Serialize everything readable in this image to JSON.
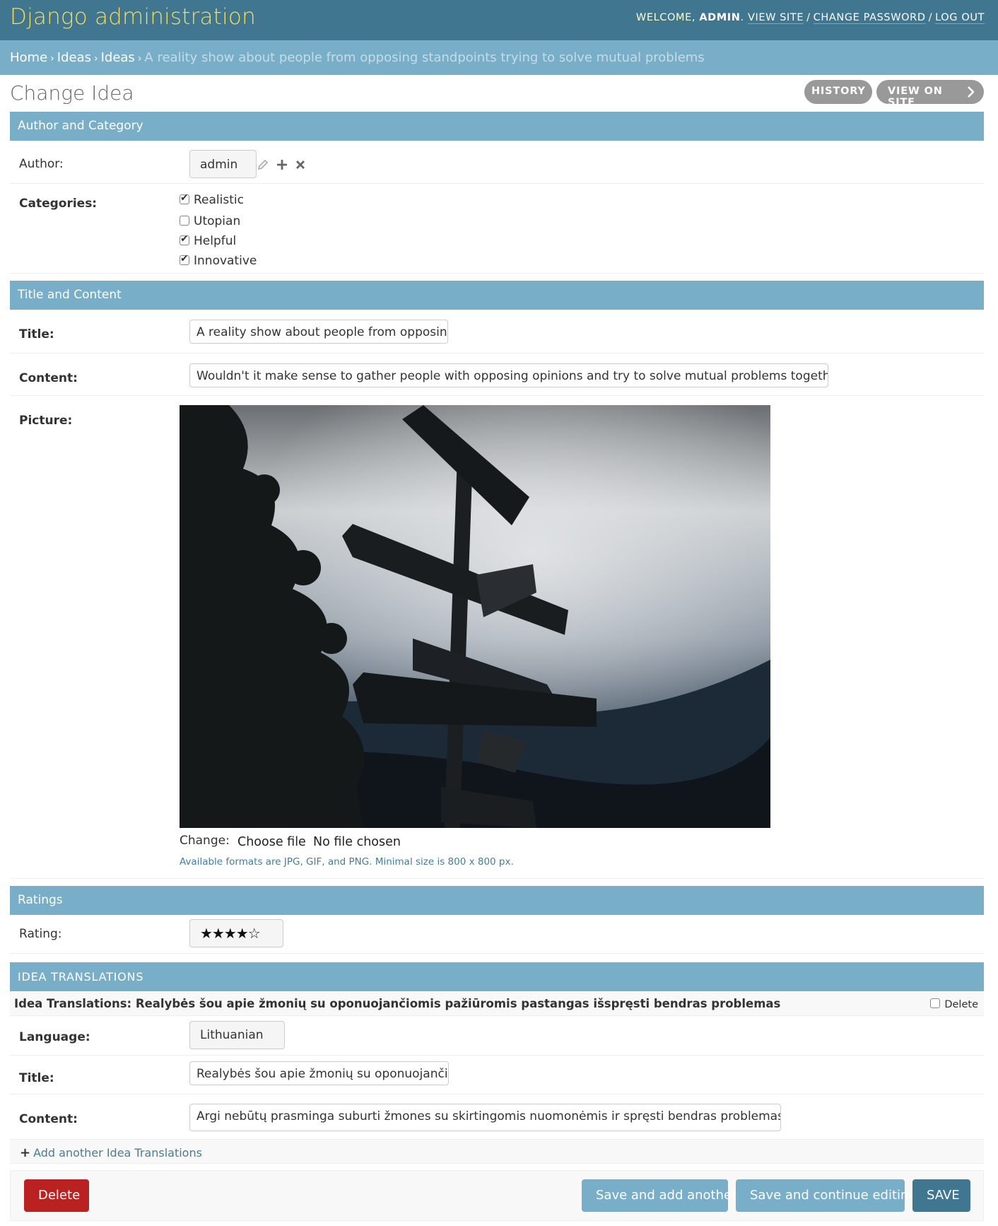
{
  "header": {
    "brand": "Django administration",
    "welcome": "WELCOME, ",
    "user": "ADMIN",
    "view_site": "VIEW SITE",
    "change_password": "CHANGE PASSWORD",
    "log_out": "LOG OUT"
  },
  "breadcrumbs": {
    "home": "Home",
    "app": "Ideas",
    "model": "Ideas",
    "current": "A reality show about people from opposing standpoints trying to solve mutual problems"
  },
  "page": {
    "title": "Change Idea",
    "history": "HISTORY",
    "view_on_site": "VIEW ON SITE"
  },
  "sections": {
    "author_category": "Author and Category",
    "title_content": "Title and Content",
    "ratings": "Ratings",
    "translations": "IDEA TRANSLATIONS"
  },
  "author": {
    "label": "Author:",
    "value": "admin"
  },
  "categories": {
    "label": "Categories:",
    "items": [
      {
        "label": "Realistic",
        "checked": true
      },
      {
        "label": "Utopian",
        "checked": false
      },
      {
        "label": "Helpful",
        "checked": true
      },
      {
        "label": "Innovative",
        "checked": true
      }
    ]
  },
  "title_field": {
    "label": "Title:",
    "value": "A reality show about people from opposing st"
  },
  "content_field": {
    "label": "Content:",
    "value": "Wouldn't it make sense to gather people with opposing opinions and try to solve mutual problems together?"
  },
  "picture": {
    "label": "Picture:",
    "change": "Change:",
    "choose_file": "Choose file",
    "no_file": "No file chosen",
    "help": "Available formats are JPG, GIF, and PNG. Minimal size is 800 x 800 px."
  },
  "rating": {
    "label": "Rating:",
    "value": "★★★★☆"
  },
  "inline": {
    "header": "Idea Translations: Realybės šou apie žmonių su oponuojančiomis pažiūromis pastangas išspręsti bendras problemas",
    "delete": "Delete",
    "language_label": "Language:",
    "language_value": "Lithuanian",
    "title_label": "Title:",
    "title_value": "Realybės šou apie žmonių su oponuojančiom",
    "content_label": "Content:",
    "content_value": "Argi nebūtų prasminga suburti žmones su skirtingomis nuomonėmis ir spręsti bendras problemas kartu?",
    "add_another": "Add another Idea Translations"
  },
  "submit": {
    "delete": "Delete",
    "save_add": "Save and add another",
    "save_continue": "Save and continue editing",
    "save": "SAVE"
  },
  "colors": {
    "header_bg": "#417690",
    "breadcrumb_bg": "#79aec8",
    "brand": "#f5dd5d",
    "delete_bg": "#ba2121"
  }
}
